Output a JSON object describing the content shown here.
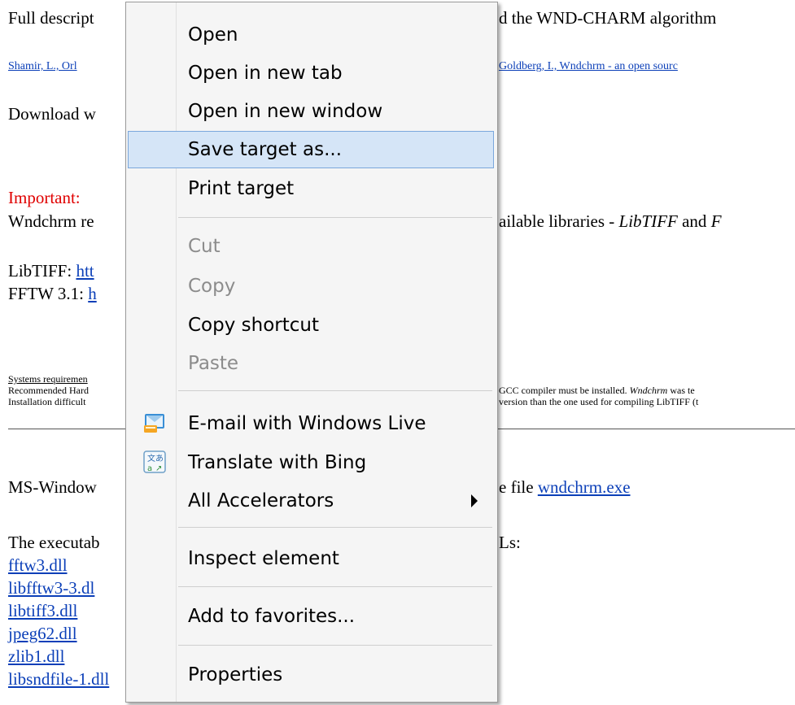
{
  "page": {
    "description_text_left": "Full descript",
    "description_text_right": "d the WND-CHARM algorithm",
    "citation_left": "Shamir, L., Orl",
    "citation_right": "Goldberg, I., Wndchrm - an open sourc",
    "download_text": "Download w",
    "important_label": "Important:",
    "requires_left": "Wndchrm re",
    "requires_right_prefix": "ailable libraries - ",
    "requires_right_italic": "LibTIFF",
    "requires_right_suffix": " and ",
    "requires_right_italic2": "F",
    "libtiff_label": "LibTIFF: ",
    "libtiff_link": "htt",
    "fftw_label": "FFTW 3.1: ",
    "fftw_link": "h",
    "sys_req_left": "Systems requiremen",
    "sys_req_line2_left": "Recommended Hard",
    "sys_req_line2_right_prefix": " GCC compiler must be installed. ",
    "sys_req_line2_right_italic": "Wndchrm",
    "sys_req_line2_right_suffix": " was te",
    "sys_req_line3_left": "Installation difficult",
    "sys_req_line3_right": "version than the one used for compiling LibTIFF (t",
    "mswindows_left": "MS-Window",
    "mswindows_right": "e file ",
    "wndchrm_exe_link": "wndchrm.exe",
    "executable_left": "The executab",
    "executable_right": "Ls:",
    "dll_links": [
      "fftw3.dll",
      "libfftw3-3.dl",
      "libtiff3.dll",
      "jpeg62.dll",
      "zlib1.dll",
      "libsndfile-1.dll"
    ]
  },
  "context_menu": {
    "items": [
      {
        "label": "Open",
        "disabled": false
      },
      {
        "label": "Open in new tab",
        "disabled": false
      },
      {
        "label": "Open in new window",
        "disabled": false
      },
      {
        "label": "Save target as...",
        "disabled": false,
        "highlighted": true
      },
      {
        "label": "Print target",
        "disabled": false
      },
      {
        "label": "Cut",
        "disabled": true
      },
      {
        "label": "Copy",
        "disabled": true
      },
      {
        "label": "Copy shortcut",
        "disabled": false
      },
      {
        "label": "Paste",
        "disabled": true
      },
      {
        "label": "E-mail with Windows Live",
        "disabled": false,
        "icon": "windows-live-mail-icon"
      },
      {
        "label": "Translate with Bing",
        "disabled": false,
        "icon": "bing-translate-icon"
      },
      {
        "label": "All Accelerators",
        "disabled": false,
        "submenu": true
      },
      {
        "label": "Inspect element",
        "disabled": false
      },
      {
        "label": "Add to favorites...",
        "disabled": false
      },
      {
        "label": "Properties",
        "disabled": false
      }
    ]
  },
  "colors": {
    "link": "#0b3fb8",
    "important": "#e00000",
    "menu_highlight": "#d5e5f7",
    "menu_highlight_border": "#7aa7dc",
    "menu_disabled_text": "#8c8c8c"
  }
}
